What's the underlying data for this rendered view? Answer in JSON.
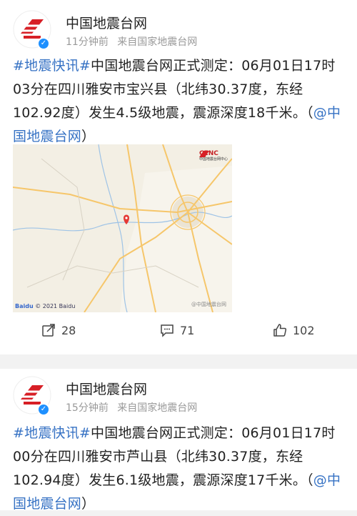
{
  "posts": [
    {
      "author": "中国地震台网",
      "time": "11分钟前",
      "source": "来自国家地震台网",
      "topic1": "#地震快讯#",
      "body": "中国地震台网正式测定：06月01日17时03分在四川雅安市宝兴县（北纬30.37度，东经102.92度）发生4.5级地震，震源深度18千米。（",
      "mention": "@中国地震台网",
      "tail": "）",
      "map": {
        "logo_text": "CENC",
        "logo_sub": "中国地震台网中心",
        "baidu": "Baidu",
        "baidu_copy": "© 2021 Baidu",
        "watermark": "@中国地震台网"
      },
      "shares": "28",
      "comments": "71",
      "likes": "102"
    },
    {
      "author": "中国地震台网",
      "time": "15分钟前",
      "source": "来自国家地震台网",
      "topic1": "#地震快讯#",
      "body": "中国地震台网正式测定：06月01日17时00分在四川雅安市芦山县（北纬30.37度，东经102.94度）发生6.1级地震，震源深度17千米。（",
      "mention": "@中国地震台网",
      "tail": "）"
    }
  ],
  "colors": {
    "link": "#3672c4",
    "brand_red": "#d71f26",
    "verified": "#1e90ff"
  }
}
